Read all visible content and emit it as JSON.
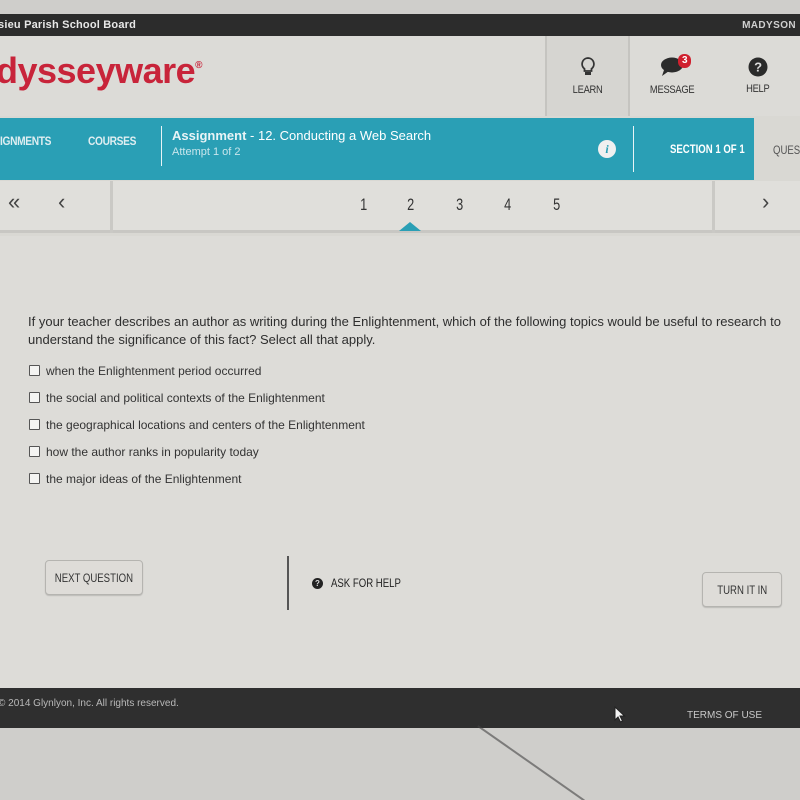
{
  "org_bar": {
    "org_name": "sieu Parish School Board",
    "user_name": "MADYSON"
  },
  "header": {
    "logo": "dysseyware",
    "buttons": [
      {
        "label": "LEARN",
        "icon": "lightbulb-icon"
      },
      {
        "label": "MESSAGE",
        "icon": "chat-bubble-icon",
        "badge": "3"
      },
      {
        "label": "HELP",
        "icon": "question-circle-icon"
      }
    ]
  },
  "nav": {
    "items": [
      "IGNMENTS",
      "COURSES"
    ],
    "assignment_label": "Assignment",
    "assignment_title": " - 12. Conducting a Web Search",
    "attempt": "Attempt 1 of 2",
    "section": "SECTION 1 OF 1",
    "question_tab": "QUES"
  },
  "pager": {
    "first_icon": "«",
    "prev_icon": "‹",
    "next_icon": "›",
    "pages": [
      "1",
      "2",
      "3",
      "4",
      "5"
    ],
    "current_page": "2"
  },
  "question": {
    "text": "If your teacher describes an author as writing during the Enlightenment, which of the following topics would be useful to research to understand the significance of this fact? Select all that apply.",
    "options": [
      {
        "label": "when the Enlightenment period occurred",
        "checked": false
      },
      {
        "label": "the social and political contexts of the Enlightenment",
        "checked": false
      },
      {
        "label": "the geographical locations and centers of the Enlightenment",
        "checked": false
      },
      {
        "label": "how the author ranks in popularity today",
        "checked": false
      },
      {
        "label": "the major ideas of the Enlightenment",
        "checked": false
      }
    ]
  },
  "actions": {
    "next_question": "NEXT QUESTION",
    "ask_for_help": "ASK FOR HELP",
    "turn_it_in": "TURN IT IN"
  },
  "footer": {
    "copyright": "© 2014 Glynlyon, Inc. All rights reserved.",
    "terms": "TERMS OF USE"
  },
  "colors": {
    "brand_red": "#c8243a",
    "nav_teal": "#2a9fb5",
    "badge_red": "#d0202e",
    "footer_dark": "#2f2f2f"
  }
}
